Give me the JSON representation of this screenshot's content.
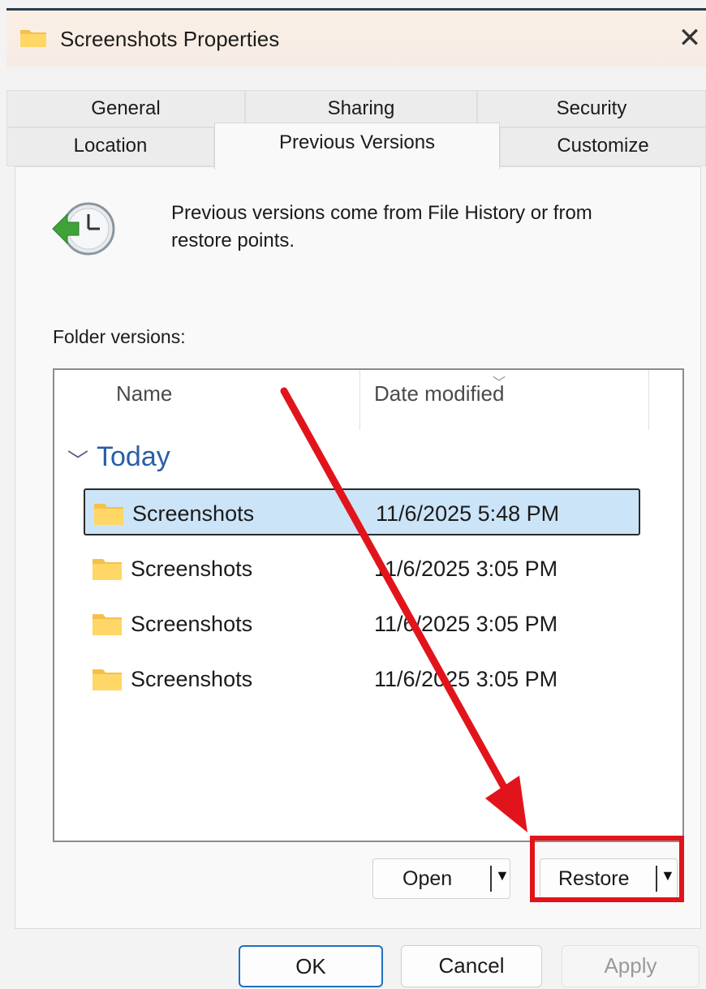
{
  "window": {
    "title": "Screenshots Properties",
    "close_label": "✕"
  },
  "tabs": {
    "row1": [
      {
        "label": "General",
        "active": false
      },
      {
        "label": "Sharing",
        "active": false
      },
      {
        "label": "Security",
        "active": false
      }
    ],
    "row2": [
      {
        "label": "Location",
        "active": false
      },
      {
        "label": "Previous Versions",
        "active": true
      },
      {
        "label": "Customize",
        "active": false
      }
    ]
  },
  "info": {
    "text": "Previous versions come from File History or from restore points."
  },
  "versions": {
    "label": "Folder versions:",
    "columns": [
      "Name",
      "Date modified"
    ],
    "group": "Today",
    "rows": [
      {
        "name": "Screenshots",
        "date": "11/6/2025 5:48 PM",
        "selected": true
      },
      {
        "name": "Screenshots",
        "date": "11/6/2025 3:05 PM",
        "selected": false
      },
      {
        "name": "Screenshots",
        "date": "11/6/2025 3:05 PM",
        "selected": false
      },
      {
        "name": "Screenshots",
        "date": "11/6/2025 3:05 PM",
        "selected": false
      }
    ]
  },
  "actions": {
    "open_label": "Open",
    "restore_label": "Restore"
  },
  "dialog_buttons": {
    "ok": "OK",
    "cancel": "Cancel",
    "apply": "Apply"
  },
  "colors": {
    "annotation": "#e2141b",
    "selection": "#cce4f7",
    "group_text": "#2a5da8"
  },
  "icons": {
    "title": "folder-icon",
    "info": "history-clock-icon",
    "row": "folder-icon",
    "dropdown": "caret-down-icon"
  }
}
